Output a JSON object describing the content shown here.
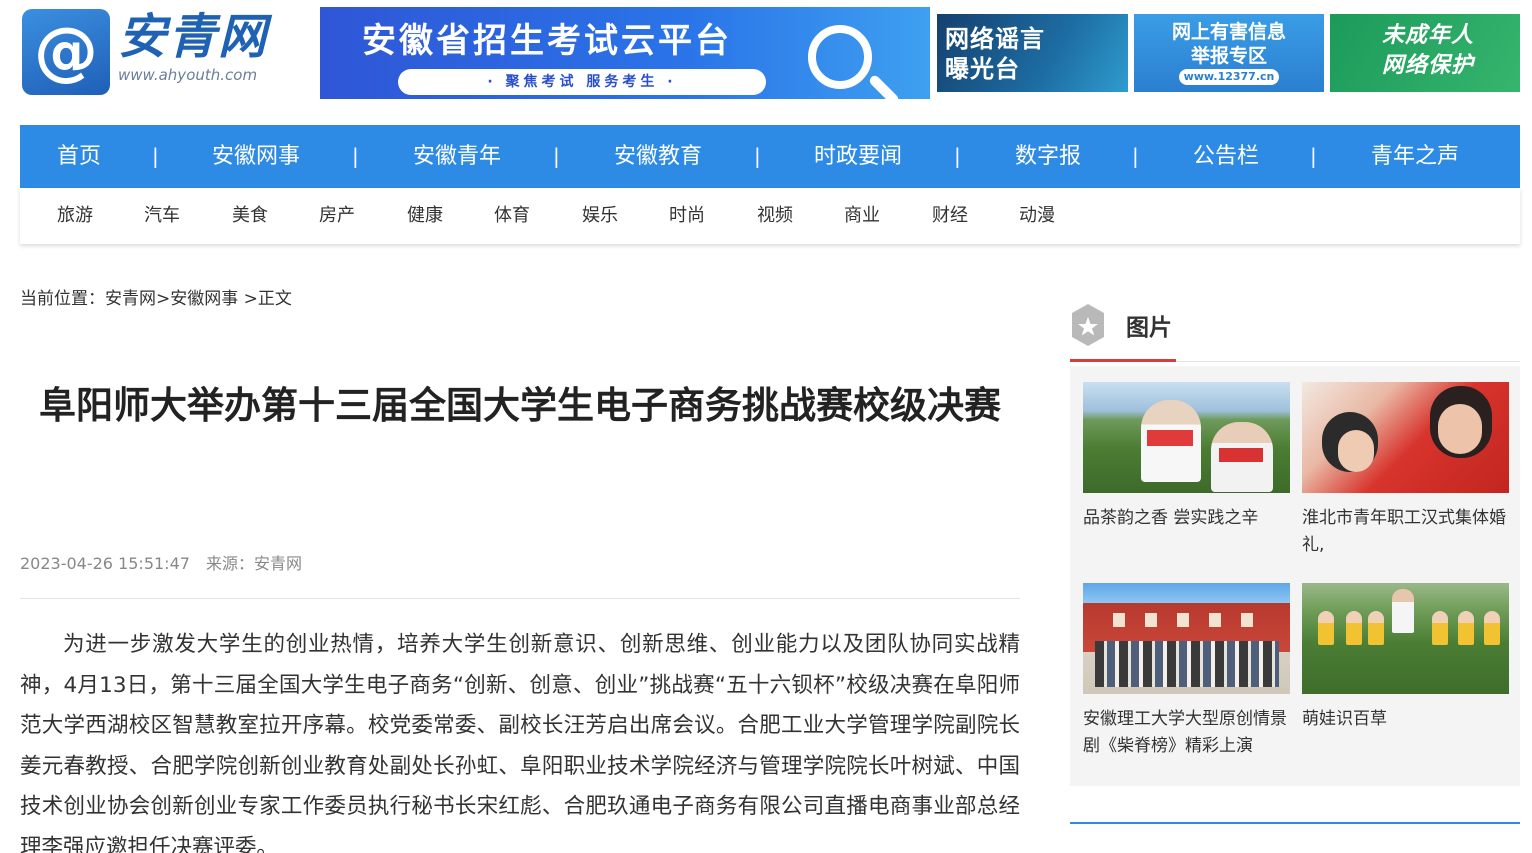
{
  "header": {
    "logo_cn": "安青网",
    "logo_url": "www.ahyouth.com",
    "banner_main_title": "安徽省招生考试云平台",
    "banner_main_sub": "· 聚焦考试 服务考生 ·",
    "banner_rumor": "网络谣言\n曝光台",
    "banner_report_title": "网上有害信息\n举报专区",
    "banner_report_url": "www.12377.cn",
    "banner_minor": "未成年人\n网络保护"
  },
  "nav": {
    "items": [
      "首页",
      "安徽网事",
      "安徽青年",
      "安徽教育",
      "时政要闻",
      "数字报",
      "公告栏",
      "青年之声"
    ],
    "separator": "|"
  },
  "subnav": {
    "items": [
      "旅游",
      "汽车",
      "美食",
      "房产",
      "健康",
      "体育",
      "娱乐",
      "时尚",
      "视频",
      "商业",
      "财经",
      "动漫"
    ]
  },
  "breadcrumb": {
    "prefix": "当前位置：",
    "items": [
      "安青网",
      ">",
      "安徽网事",
      " >",
      "正文"
    ]
  },
  "article": {
    "title": "阜阳师大举办第十三届全国大学生电子商务挑战赛校级决赛",
    "date": "2023-04-26 15:51:47",
    "source": "来源：安青网",
    "paragraph": "为进一步激发大学生的创业热情，培养大学生创新意识、创新思维、创业能力以及团队协同实战精神，4月13日，第十三届全国大学生电子商务“创新、创意、创业”挑战赛“五十六钡杯”校级决赛在阜阳师范大学西湖校区智慧教室拉开序幕。校党委常委、副校长汪芳启出席会议。合肥工业大学管理学院副院长姜元春教授、合肥学院创新创业教育处副处长孙虹、阜阳职业技术学院经济与管理学院院长叶树斌、中国技术创业协会创新创业专家工作委员执行秘书长宋红彪、合肥玖通电子商务有限公司直播电商事业部总经理李强应邀担任决赛评委。"
  },
  "sidebar": {
    "section_title": "图片",
    "pictures": [
      {
        "caption": "品茶韵之香 尝实践之辛"
      },
      {
        "caption": "淮北市青年职工汉式集体婚礼,"
      },
      {
        "caption": "安徽理工大学大型原创情景剧《柴脊榜》精彩上演"
      },
      {
        "caption": "萌娃识百草"
      }
    ]
  },
  "colors": {
    "nav_blue": "#2d8be6",
    "accent_red": "#d83b3b"
  }
}
